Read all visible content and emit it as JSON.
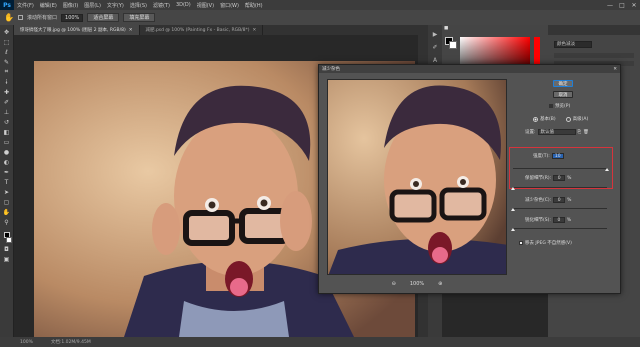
{
  "app": {
    "logo": "Ps"
  },
  "menu": [
    "文件(F)",
    "编辑(E)",
    "图像(I)",
    "图层(L)",
    "文字(Y)",
    "选择(S)",
    "滤镜(T)",
    "3D(D)",
    "视图(V)",
    "窗口(W)",
    "帮助(H)"
  ],
  "window_controls": {
    "min": "—",
    "max": "□",
    "close": "✕"
  },
  "options_bar": {
    "tool_icon": "hand-icon",
    "scroll_all_label": "滚动所有窗口",
    "zoom_value": "100%",
    "fit_screen_label": "适合屏幕",
    "fill_screen_label": "填充屏幕"
  },
  "tabs": [
    {
      "label": "惊讶搞怪大了眼.jpg @ 100% (图层 2 副本, RGB/8)",
      "active": true
    },
    {
      "label": "减肥.psd @ 100% (Painting Fx - Basic, RGB/8*)",
      "active": false
    }
  ],
  "tools": [
    "move-icon",
    "marquee-icon",
    "lasso-icon",
    "quick-select-icon",
    "crop-icon",
    "eyedropper-icon",
    "heal-icon",
    "brush-icon",
    "stamp-icon",
    "history-brush-icon",
    "eraser-icon",
    "gradient-icon",
    "blur-icon",
    "dodge-icon",
    "pen-icon",
    "type-icon",
    "path-select-icon",
    "shape-icon",
    "hand-icon",
    "zoom-icon"
  ],
  "status": {
    "zoom": "100%",
    "doc": "文档:1.02M/9.45M"
  },
  "layers_panel": {
    "blend_mode": "颜色减淡",
    "colors": {
      "panel": "#454545",
      "head": "#353535"
    }
  },
  "dialog": {
    "title": "减少杂色",
    "close_label": "✕",
    "ok_label": "确定",
    "cancel_label": "取消",
    "preview_label": "预览(P)",
    "basic_label": "基本(B)",
    "advanced_label": "高级(A)",
    "settings_label": "设置:",
    "settings_value": "默认值",
    "strength_label": "强度(T):",
    "strength_value": "10",
    "preserve_detail_label": "保留细节(R):",
    "preserve_detail_value": "0",
    "reduce_color_label": "减少杂色(C):",
    "reduce_color_value": "0",
    "sharpen_label": "锐化细节(S):",
    "sharpen_value": "0",
    "jpeg_label": "移去 JPEG 不自然感(V)",
    "percent": "%",
    "zoom_value": "100%",
    "zoom_out": "⊖",
    "zoom_in": "⊕",
    "slider_levels": {
      "strength": 1.0,
      "preserve_detail": 0.0,
      "reduce_color": 0.0,
      "sharpen": 0.0
    },
    "colors": {
      "highlight_box": "#d6343c",
      "field_highlight": "#2a63b0"
    }
  }
}
